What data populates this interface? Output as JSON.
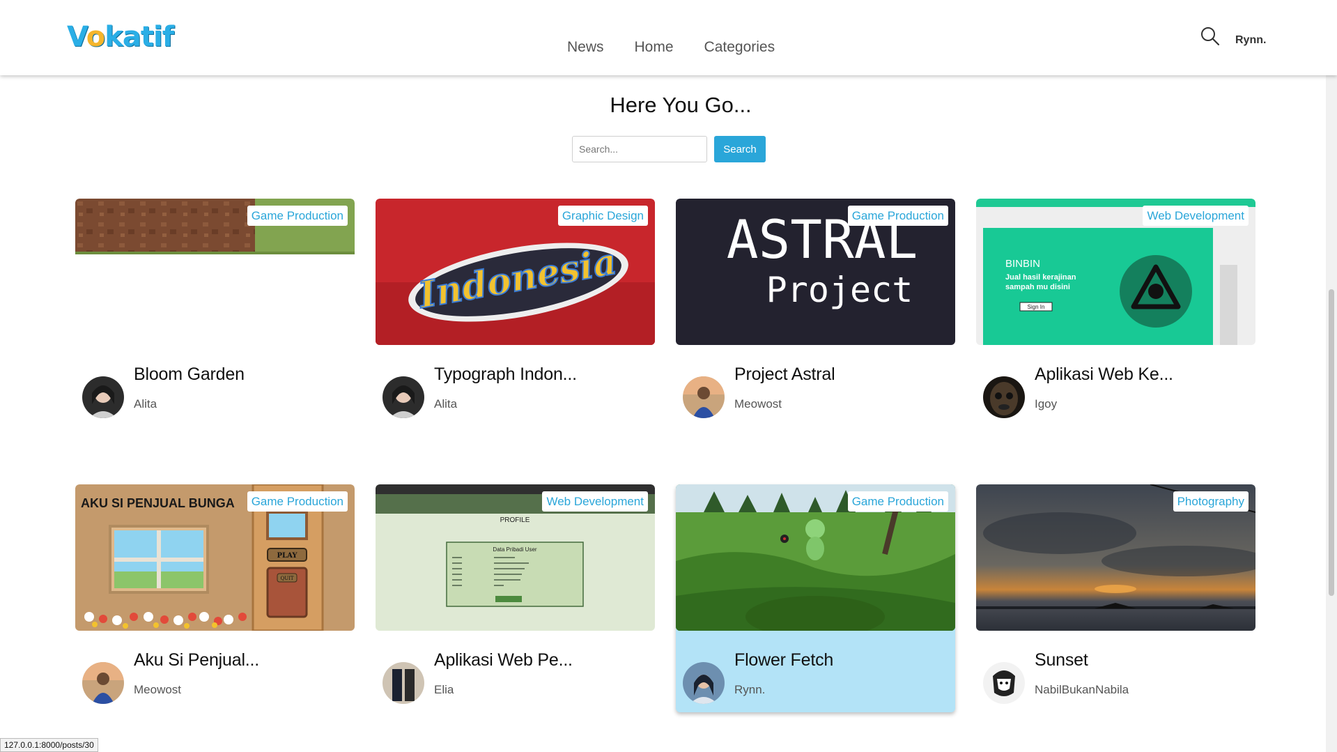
{
  "nav": {
    "logo": "Vokatif",
    "links": [
      "News",
      "Home",
      "Categories"
    ],
    "search_icon": "search-icon",
    "user": "Rynn."
  },
  "header": {
    "title": "Here You Go...",
    "search_placeholder": "Search...",
    "search_button": "Search"
  },
  "posts": [
    {
      "title": "Bloom Garden",
      "author": "Alita",
      "category": "Game Production"
    },
    {
      "title": "Typograph Indon...",
      "author": "Alita",
      "category": "Graphic Design"
    },
    {
      "title": "Project Astral",
      "author": "Meowost",
      "category": "Game Production"
    },
    {
      "title": "Aplikasi Web Ke...",
      "author": "Igoy",
      "category": "Web Development"
    },
    {
      "title": "Aku Si Penjual...",
      "author": "Meowost",
      "category": "Game Production"
    },
    {
      "title": "Aplikasi Web Pe...",
      "author": "Elia",
      "category": "Web Development"
    },
    {
      "title": "Flower Fetch",
      "author": "Rynn.",
      "category": "Game Production"
    },
    {
      "title": "Sunset",
      "author": "NabilBukanNabila",
      "category": "Photography"
    }
  ],
  "thumb_text": {
    "typograph": "Indonesia",
    "astral_1": "ASTRAL",
    "astral_2": "Project",
    "binbin_brand": "BINBIN",
    "binbin_line1": "Jual hasil kerajinan",
    "binbin_line2": "sampah mu disini",
    "binbin_button": "Sign In",
    "penjual_title": "AKU SI PENJUAL BUNGA",
    "penjual_play": "PLAY",
    "penjual_quit": "QUIT",
    "profile_heading": "PROFILE",
    "profile_box": "Data Pribadi User"
  },
  "status_url": "127.0.0.1:8000/posts/30",
  "colors": {
    "accent": "#2aa6d9",
    "logo_blue": "#2aaee6",
    "logo_o": "#f5b52c",
    "active_card": "#b3e3f7"
  }
}
